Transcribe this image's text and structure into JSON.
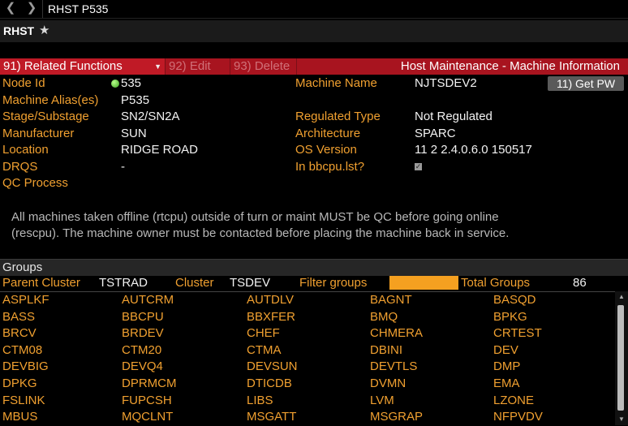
{
  "command_bar": {
    "back_icon": "chevron-left-icon",
    "forward_icon": "chevron-right-icon",
    "command": "RHST P535"
  },
  "title": {
    "text": "RHST",
    "star_icon": "star-icon"
  },
  "menu": {
    "related": "91) Related Functions",
    "edit": "92) Edit",
    "delete": "93) Delete",
    "page_title": "Host Maintenance - Machine Information"
  },
  "fields": {
    "node_id_label": "Node Id",
    "node_id_value": "535",
    "machine_name_label": "Machine Name",
    "machine_name_value": "NJTSDEV2",
    "get_pw": "11) Get PW",
    "machine_alias_label": "Machine Alias(es)",
    "machine_alias_value": "P535",
    "stage_label": "Stage/Substage",
    "stage_value": "SN2/SN2A",
    "regulated_label": "Regulated Type",
    "regulated_value": "Not Regulated",
    "manufacturer_label": "Manufacturer",
    "manufacturer_value": "SUN",
    "architecture_label": "Architecture",
    "architecture_value": "SPARC",
    "location_label": "Location",
    "location_value": "RIDGE ROAD",
    "os_label": "OS Version",
    "os_value": "11 2 2.4.0.6.0 150517",
    "drqs_label": "DRQS",
    "drqs_value": "-",
    "bbcpu_label": "In bbcpu.lst?",
    "bbcpu_checked": true,
    "qc_label": "QC Process"
  },
  "notice": {
    "line1": "All machines taken offline (rtcpu) outside of turn or maint MUST be QC before going online",
    "line2": "(rescpu). The machine owner must be contacted before placing the machine back in service."
  },
  "groups": {
    "title": "Groups",
    "parent_cluster_label": "Parent Cluster",
    "parent_cluster_value": "TSTRAD",
    "cluster_label": "Cluster",
    "cluster_value": "TSDEV",
    "filter_label": "Filter groups",
    "filter_value": "",
    "total_label": "Total Groups",
    "total_value": "86",
    "rows": [
      [
        "ASPLKF",
        "AUTCRM",
        "AUTDLV",
        "BAGNT",
        "BASQD"
      ],
      [
        "BASS",
        "BBCPU",
        "BBXFER",
        "BMQ",
        "BPKG"
      ],
      [
        "BRCV",
        "BRDEV",
        "CHEF",
        "CHMERA",
        "CRTEST"
      ],
      [
        "CTM08",
        "CTM20",
        "CTMA",
        "DBINI",
        "DEV"
      ],
      [
        "DEVBIG",
        "DEVQ4",
        "DEVSUN",
        "DEVTLS",
        "DMP"
      ],
      [
        "DPKG",
        "DPRMCM",
        "DTICDB",
        "DVMN",
        "EMA"
      ],
      [
        "FSLINK",
        "FUPCSH",
        "LIBS",
        "LVM",
        "LZONE"
      ],
      [
        "MBUS",
        "MQCLNT",
        "MSGATT",
        "MSGRAP",
        "NFPVDV"
      ]
    ]
  },
  "colors": {
    "background": "#000000",
    "menu_red": "#a8141f",
    "label_amber": "#f0a030",
    "status_green": "#3aa020"
  }
}
